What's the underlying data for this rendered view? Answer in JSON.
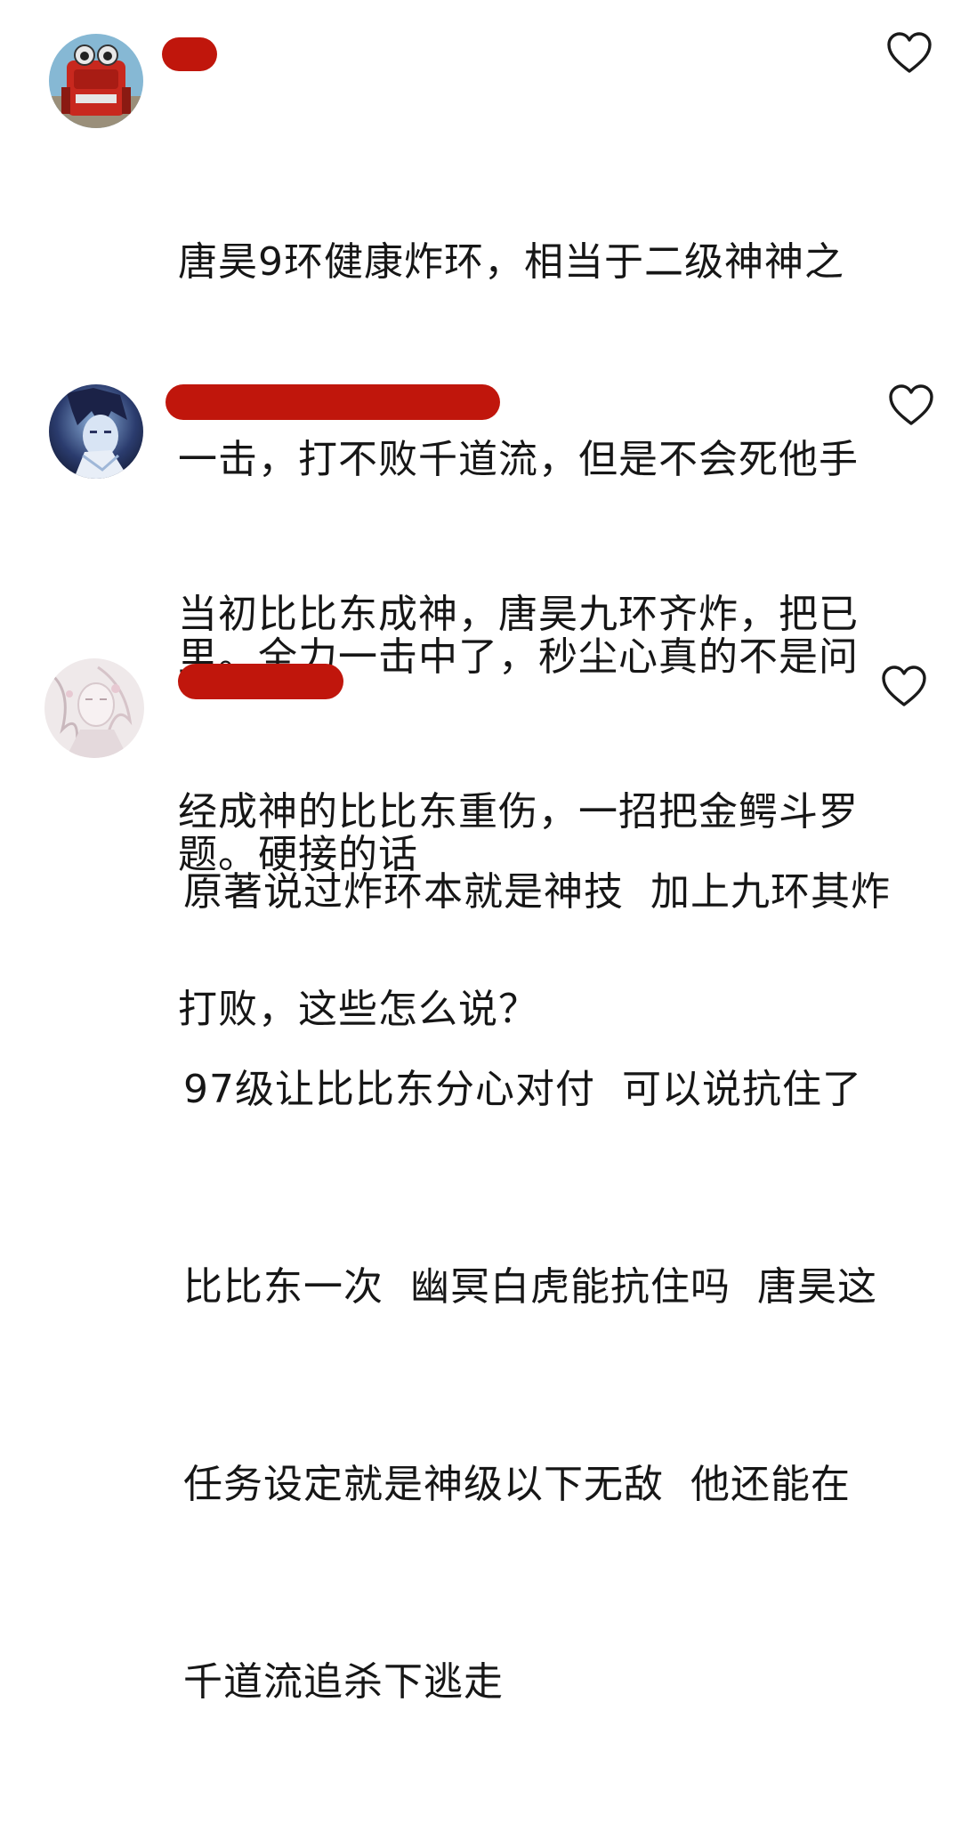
{
  "comments": [
    {
      "avatar_icon": "cartoon-robot-avatar",
      "username_redacted": true,
      "like_icon": "heart-outline-icon",
      "lines": [
        "唐昊9环健康炸环，相当于二级神神之",
        "一击，打不败千道流，但是不会死他手",
        "里。全力一击中了，秒尘心真的不是问",
        "题。硬接的话"
      ]
    },
    {
      "avatar_icon": "anime-character-avatar",
      "username_redacted": true,
      "like_icon": "heart-outline-icon",
      "lines": [
        "当初比比东成神，唐昊九环齐炸，把已",
        "经成神的比比东重伤，一招把金鳄斗罗",
        "打败，这些怎么说？"
      ]
    },
    {
      "avatar_icon": "illustrated-portrait-avatar",
      "username_redacted": true,
      "like_icon": "heart-outline-icon",
      "lines": [
        "原著说过炸环本就是神技  加上九环其炸",
        "97级让比比东分心对付  可以说抗住了",
        "比比东一次  幽冥白虎能抗住吗  唐昊这",
        "任务设定就是神级以下无敌  他还能在",
        "千道流追杀下逃走"
      ]
    }
  ],
  "colors": {
    "redaction": "#c0160c",
    "text": "#161616",
    "icon_stroke": "#1a1a1a",
    "background": "#ffffff"
  }
}
